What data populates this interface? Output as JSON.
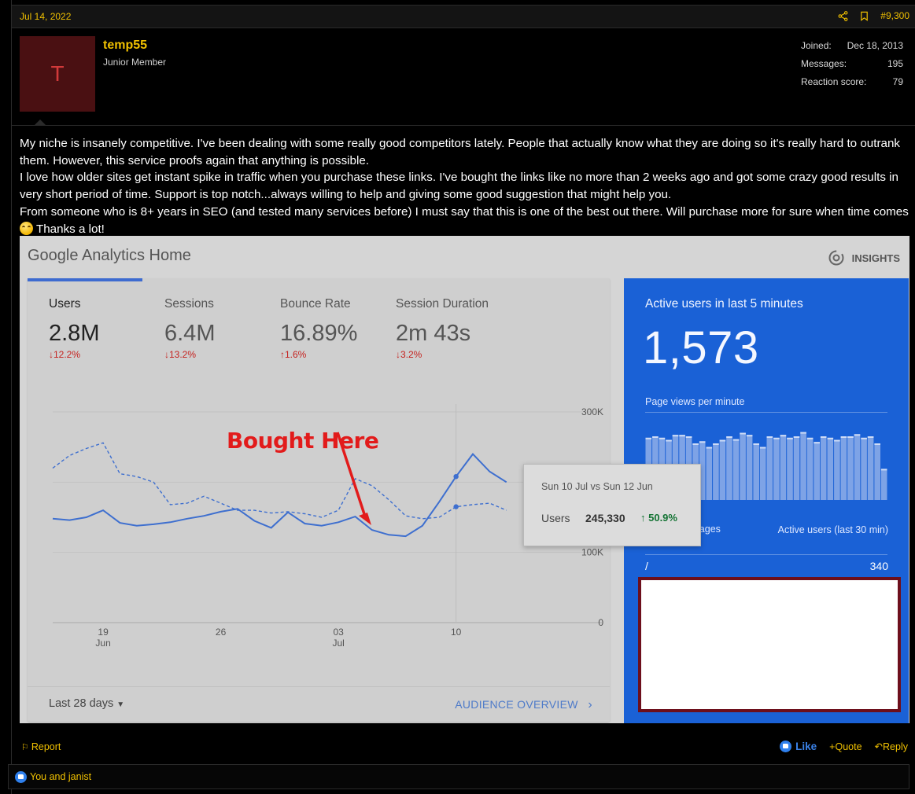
{
  "post": {
    "date": "Jul 14, 2022",
    "number": "#9,300"
  },
  "user": {
    "avatar_letter": "T",
    "name": "temp55",
    "title": "Junior Member",
    "stats": {
      "joined_label": "Joined:",
      "joined_value": "Dec 18, 2013",
      "messages_label": "Messages:",
      "messages_value": "195",
      "reaction_label": "Reaction score:",
      "reaction_value": "79"
    }
  },
  "message": {
    "p1": "My niche is insanely competitive. I've been dealing with some really good competitors lately. People that actually know what they are doing so it's really hard to outrank them. However, this service proofs again that anything is possible.",
    "p2": "I love how older sites get instant spike in traffic when you purchase these links. I've bought the links like no more than 2 weeks ago and got some crazy good results in very short period of time. Support is top notch...always willing to help and giving some good suggestion that might help you.",
    "p3": "From someone who is 8+ years in SEO (and tested many services before) I must say that this is one of the best out there. Will purchase more for sure when time comes",
    "p3_end": "Thanks a lot!"
  },
  "analytics": {
    "title": "Google Analytics Home",
    "insights_label": "INSIGHTS",
    "metrics": [
      {
        "label": "Users",
        "value": "2.8M",
        "change": "12.2%",
        "direction": "down"
      },
      {
        "label": "Sessions",
        "value": "6.4M",
        "change": "13.2%",
        "direction": "down"
      },
      {
        "label": "Bounce Rate",
        "value": "16.89%",
        "change": "1.6%",
        "direction": "up"
      },
      {
        "label": "Session Duration",
        "value": "2m 43s",
        "change": "3.2%",
        "direction": "down"
      }
    ],
    "annotation": "Bought Here",
    "tooltip": {
      "title": "Sun 10 Jul vs Sun 12 Jun",
      "metric": "Users",
      "value": "245,330",
      "change": "↑ 50.9%"
    },
    "range_label": "Last 28 days",
    "audience_link": "AUDIENCE OVERVIEW",
    "realtime": {
      "title": "Active users in last 5 minutes",
      "count": "1,573",
      "subtitle": "Page views per minute",
      "col1": "Top Active Pages",
      "col2": "Active users (last 30 min)",
      "page": "/",
      "page_users": "340",
      "bar_values": [
        0.88,
        0.9,
        0.88,
        0.85,
        0.92,
        0.92,
        0.9,
        0.8,
        0.83,
        0.75,
        0.8,
        0.85,
        0.9,
        0.86,
        0.95,
        0.92,
        0.8,
        0.75,
        0.9,
        0.88,
        0.92,
        0.88,
        0.9,
        0.96,
        0.88,
        0.82,
        0.9,
        0.88,
        0.85,
        0.9,
        0.9,
        0.93,
        0.88,
        0.9,
        0.8,
        0.44
      ]
    },
    "accent_color": "#3d6bd0"
  },
  "chart_data": {
    "type": "line",
    "title": "",
    "x_tick_labels": [
      {
        "day": "19",
        "month": "Jun"
      },
      {
        "day": "26",
        "month": ""
      },
      {
        "day": "03",
        "month": "Jul"
      },
      {
        "day": "10",
        "month": ""
      }
    ],
    "y_tick_labels": [
      "300K",
      "100K",
      "0"
    ],
    "ylim": [
      0,
      300000
    ],
    "series": [
      {
        "style": "solid",
        "values": [
          148000,
          146000,
          150000,
          160000,
          142000,
          138000,
          140000,
          143000,
          148000,
          152000,
          158000,
          162000,
          145000,
          135000,
          157000,
          141000,
          138000,
          143000,
          151000,
          132000,
          125000,
          123000,
          138000,
          172000,
          208000,
          240000,
          215000,
          200000
        ]
      },
      {
        "style": "dashed",
        "values": [
          220000,
          238000,
          248000,
          256000,
          212000,
          208000,
          200000,
          168000,
          170000,
          180000,
          170000,
          160000,
          160000,
          156000,
          158000,
          155000,
          150000,
          160000,
          205000,
          195000,
          175000,
          152000,
          148000,
          150000,
          165000,
          168000,
          170000,
          160000
        ]
      }
    ]
  },
  "footer": {
    "report": "Report",
    "like": "Like",
    "quote": "Quote",
    "reply": "Reply",
    "reactions": "You and janist"
  }
}
